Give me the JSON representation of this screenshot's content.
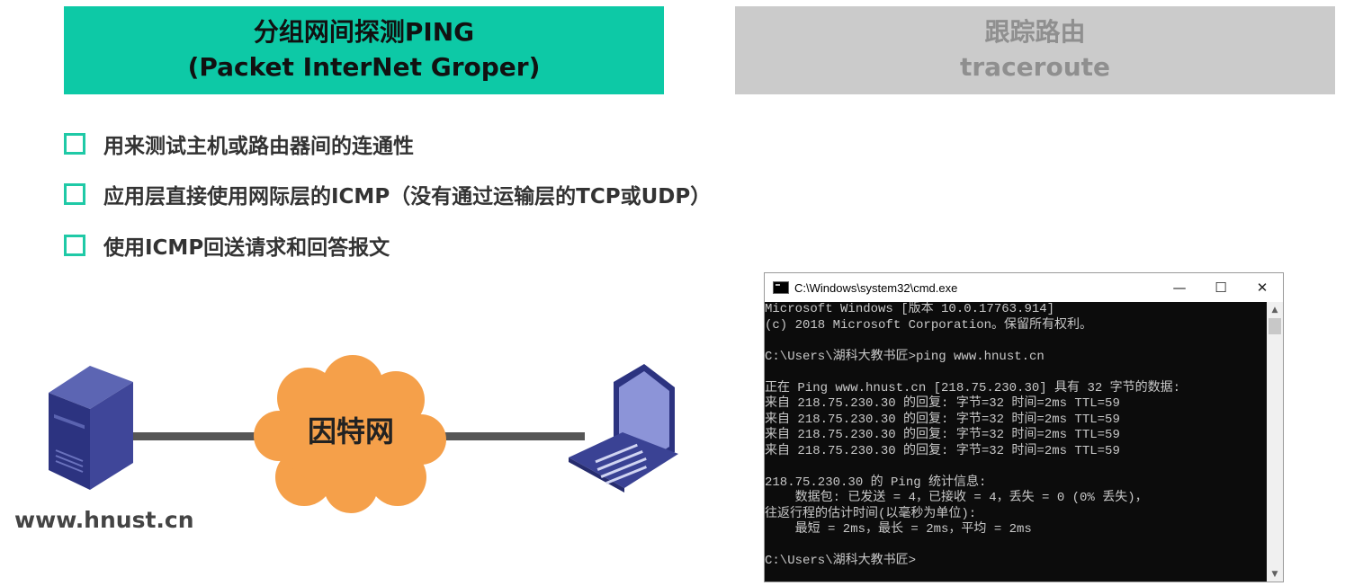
{
  "tabs": {
    "ping": {
      "title": "分组网间探测PING",
      "subtitle": "(Packet InterNet Groper)"
    },
    "traceroute": {
      "title": "跟踪路由",
      "subtitle": "traceroute"
    }
  },
  "bullets": [
    "用来测试主机或路由器间的连通性",
    "应用层直接使用网际层的ICMP（没有通过运输层的TCP或UDP）",
    "使用ICMP回送请求和回答报文"
  ],
  "diagram": {
    "cloud_label": "因特网",
    "host_label": "www.hnust.cn"
  },
  "cmd": {
    "title": "C:\\Windows\\system32\\cmd.exe",
    "controls": {
      "minimize": "—",
      "maximize": "☐",
      "close": "✕"
    },
    "lines": [
      "Microsoft Windows [版本 10.0.17763.914]",
      "(c) 2018 Microsoft Corporation。保留所有权利。",
      "",
      "C:\\Users\\湖科大教书匠>ping www.hnust.cn",
      "",
      "正在 Ping www.hnust.cn [218.75.230.30] 具有 32 字节的数据:",
      "来自 218.75.230.30 的回复: 字节=32 时间=2ms TTL=59",
      "来自 218.75.230.30 的回复: 字节=32 时间=2ms TTL=59",
      "来自 218.75.230.30 的回复: 字节=32 时间=2ms TTL=59",
      "来自 218.75.230.30 的回复: 字节=32 时间=2ms TTL=59",
      "",
      "218.75.230.30 的 Ping 统计信息:",
      "    数据包: 已发送 = 4，已接收 = 4，丢失 = 0 (0% 丢失)，",
      "往返行程的估计时间(以毫秒为单位):",
      "    最短 = 2ms，最长 = 2ms，平均 = 2ms",
      "",
      "C:\\Users\\湖科大教书匠>"
    ]
  }
}
